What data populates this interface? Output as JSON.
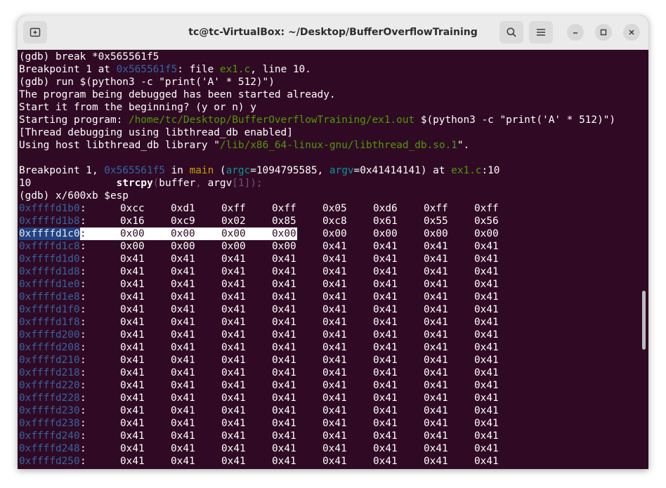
{
  "window": {
    "title": "tc@tc-VirtualBox: ~/Desktop/BufferOverflowTraining",
    "buttons": {
      "new_tab": "new-tab-icon",
      "search": "search-icon",
      "menu": "hamburger-menu-icon",
      "minimize": "minimize-icon",
      "maximize": "maximize-icon",
      "close": "close-icon"
    }
  },
  "terminal": {
    "lines": [
      {
        "segs": [
          {
            "t": "(gdb) break *0x565561f5",
            "c": ""
          }
        ]
      },
      {
        "segs": [
          {
            "t": "Breakpoint 1 at ",
            "c": ""
          },
          {
            "t": "0x565561f5",
            "c": "c-addr"
          },
          {
            "t": ": file ",
            "c": ""
          },
          {
            "t": "ex1.c",
            "c": "c-file"
          },
          {
            "t": ", line 10.",
            "c": ""
          }
        ]
      },
      {
        "segs": [
          {
            "t": "(gdb) run $(python3 -c \"print('A' * 512)\")",
            "c": ""
          }
        ]
      },
      {
        "segs": [
          {
            "t": "The program being debugged has been started already.",
            "c": ""
          }
        ]
      },
      {
        "segs": [
          {
            "t": "Start it from the beginning? (y or n) y",
            "c": ""
          }
        ]
      },
      {
        "segs": [
          {
            "t": "Starting program: ",
            "c": ""
          },
          {
            "t": "/home/tc/Desktop/BufferOverflowTraining/ex1.out",
            "c": "c-file"
          },
          {
            "t": " $(python3 -c \"print('A' * 512)\")",
            "c": ""
          }
        ]
      },
      {
        "segs": [
          {
            "t": "[Thread debugging using libthread_db enabled]",
            "c": ""
          }
        ]
      },
      {
        "segs": [
          {
            "t": "Using host libthread_db library \"",
            "c": ""
          },
          {
            "t": "/lib/x86_64-linux-gnu/libthread_db.so.1",
            "c": "c-file"
          },
          {
            "t": "\".",
            "c": ""
          }
        ]
      },
      {
        "segs": [
          {
            "t": "",
            "c": ""
          }
        ]
      },
      {
        "segs": [
          {
            "t": "Breakpoint 1, ",
            "c": ""
          },
          {
            "t": "0x565561f5",
            "c": "c-addr"
          },
          {
            "t": " in ",
            "c": ""
          },
          {
            "t": "main",
            "c": "c-func"
          },
          {
            "t": " (",
            "c": ""
          },
          {
            "t": "argc",
            "c": "c-gdb-arg"
          },
          {
            "t": "=1094795585, ",
            "c": ""
          },
          {
            "t": "argv",
            "c": "c-gdb-arg"
          },
          {
            "t": "=0x41414141) at ",
            "c": ""
          },
          {
            "t": "ex1.c",
            "c": "c-file"
          },
          {
            "t": ":10",
            "c": ""
          }
        ]
      },
      {
        "segs": [
          {
            "t": "10              ",
            "c": ""
          },
          {
            "t": "strcpy",
            "c": "c-bold"
          },
          {
            "t": "(",
            "c": "c-paren"
          },
          {
            "t": "buffer",
            "c": ""
          },
          {
            "t": ", ",
            "c": "c-paren"
          },
          {
            "t": "argv",
            "c": ""
          },
          {
            "t": "[",
            "c": "c-paren"
          },
          {
            "t": "1",
            "c": "c-num"
          },
          {
            "t": "]);",
            "c": "c-paren"
          }
        ]
      },
      {
        "segs": [
          {
            "t": "(gdb) x/600xb $esp",
            "c": ""
          }
        ]
      }
    ],
    "memory": [
      {
        "addr": "0xffffd1b0",
        "bytes": [
          "0xcc",
          "0xd1",
          "0xff",
          "0xff",
          "0x05",
          "0xd6",
          "0xff",
          "0xff"
        ]
      },
      {
        "addr": "0xffffd1b8",
        "bytes": [
          "0x16",
          "0xc9",
          "0x02",
          "0x85",
          "0xc8",
          "0x61",
          "0x55",
          "0x56"
        ]
      },
      {
        "addr": "0xffffd1c0",
        "bytes": [
          "0x00",
          "0x00",
          "0x00",
          "0x00",
          "0x00",
          "0x00",
          "0x00",
          "0x00"
        ],
        "highlight": true
      },
      {
        "addr": "0xffffd1c8",
        "bytes": [
          "0x00",
          "0x00",
          "0x00",
          "0x00",
          "0x41",
          "0x41",
          "0x41",
          "0x41"
        ]
      },
      {
        "addr": "0xffffd1d0",
        "bytes": [
          "0x41",
          "0x41",
          "0x41",
          "0x41",
          "0x41",
          "0x41",
          "0x41",
          "0x41"
        ]
      },
      {
        "addr": "0xffffd1d8",
        "bytes": [
          "0x41",
          "0x41",
          "0x41",
          "0x41",
          "0x41",
          "0x41",
          "0x41",
          "0x41"
        ]
      },
      {
        "addr": "0xffffd1e0",
        "bytes": [
          "0x41",
          "0x41",
          "0x41",
          "0x41",
          "0x41",
          "0x41",
          "0x41",
          "0x41"
        ]
      },
      {
        "addr": "0xffffd1e8",
        "bytes": [
          "0x41",
          "0x41",
          "0x41",
          "0x41",
          "0x41",
          "0x41",
          "0x41",
          "0x41"
        ]
      },
      {
        "addr": "0xffffd1f0",
        "bytes": [
          "0x41",
          "0x41",
          "0x41",
          "0x41",
          "0x41",
          "0x41",
          "0x41",
          "0x41"
        ]
      },
      {
        "addr": "0xffffd1f8",
        "bytes": [
          "0x41",
          "0x41",
          "0x41",
          "0x41",
          "0x41",
          "0x41",
          "0x41",
          "0x41"
        ]
      },
      {
        "addr": "0xffffd200",
        "bytes": [
          "0x41",
          "0x41",
          "0x41",
          "0x41",
          "0x41",
          "0x41",
          "0x41",
          "0x41"
        ]
      },
      {
        "addr": "0xffffd208",
        "bytes": [
          "0x41",
          "0x41",
          "0x41",
          "0x41",
          "0x41",
          "0x41",
          "0x41",
          "0x41"
        ]
      },
      {
        "addr": "0xffffd210",
        "bytes": [
          "0x41",
          "0x41",
          "0x41",
          "0x41",
          "0x41",
          "0x41",
          "0x41",
          "0x41"
        ]
      },
      {
        "addr": "0xffffd218",
        "bytes": [
          "0x41",
          "0x41",
          "0x41",
          "0x41",
          "0x41",
          "0x41",
          "0x41",
          "0x41"
        ]
      },
      {
        "addr": "0xffffd220",
        "bytes": [
          "0x41",
          "0x41",
          "0x41",
          "0x41",
          "0x41",
          "0x41",
          "0x41",
          "0x41"
        ]
      },
      {
        "addr": "0xffffd228",
        "bytes": [
          "0x41",
          "0x41",
          "0x41",
          "0x41",
          "0x41",
          "0x41",
          "0x41",
          "0x41"
        ]
      },
      {
        "addr": "0xffffd230",
        "bytes": [
          "0x41",
          "0x41",
          "0x41",
          "0x41",
          "0x41",
          "0x41",
          "0x41",
          "0x41"
        ]
      },
      {
        "addr": "0xffffd238",
        "bytes": [
          "0x41",
          "0x41",
          "0x41",
          "0x41",
          "0x41",
          "0x41",
          "0x41",
          "0x41"
        ]
      },
      {
        "addr": "0xffffd240",
        "bytes": [
          "0x41",
          "0x41",
          "0x41",
          "0x41",
          "0x41",
          "0x41",
          "0x41",
          "0x41"
        ]
      },
      {
        "addr": "0xffffd248",
        "bytes": [
          "0x41",
          "0x41",
          "0x41",
          "0x41",
          "0x41",
          "0x41",
          "0x41",
          "0x41"
        ]
      },
      {
        "addr": "0xffffd250",
        "bytes": [
          "0x41",
          "0x41",
          "0x41",
          "0x41",
          "0x41",
          "0x41",
          "0x41",
          "0x41"
        ]
      }
    ]
  }
}
